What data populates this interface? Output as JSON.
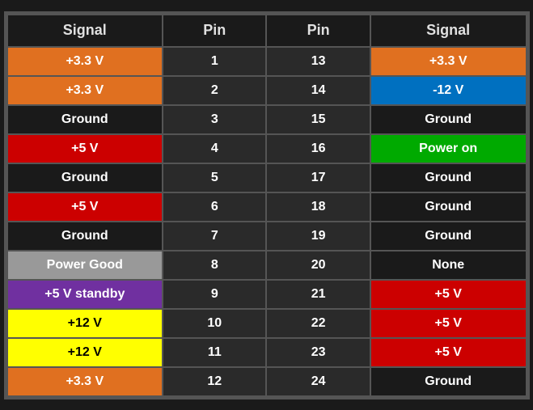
{
  "table": {
    "headers": [
      "Signal",
      "Pin",
      "Pin",
      "Signal"
    ],
    "rows": [
      {
        "left_signal": "+3.3 V",
        "left_class": "bg-orange",
        "pin_left": "1",
        "pin_right": "13",
        "right_signal": "+3.3 V",
        "right_class": "bg-orange"
      },
      {
        "left_signal": "+3.3 V",
        "left_class": "bg-orange",
        "pin_left": "2",
        "pin_right": "14",
        "right_signal": "-12 V",
        "right_class": "bg-blue"
      },
      {
        "left_signal": "Ground",
        "left_class": "bg-black",
        "pin_left": "3",
        "pin_right": "15",
        "right_signal": "Ground",
        "right_class": "bg-black"
      },
      {
        "left_signal": "+5 V",
        "left_class": "bg-red",
        "pin_left": "4",
        "pin_right": "16",
        "right_signal": "Power on",
        "right_class": "bg-green"
      },
      {
        "left_signal": "Ground",
        "left_class": "bg-black",
        "pin_left": "5",
        "pin_right": "17",
        "right_signal": "Ground",
        "right_class": "bg-black"
      },
      {
        "left_signal": "+5 V",
        "left_class": "bg-red",
        "pin_left": "6",
        "pin_right": "18",
        "right_signal": "Ground",
        "right_class": "bg-black"
      },
      {
        "left_signal": "Ground",
        "left_class": "bg-black",
        "pin_left": "7",
        "pin_right": "19",
        "right_signal": "Ground",
        "right_class": "bg-black"
      },
      {
        "left_signal": "Power Good",
        "left_class": "bg-gray",
        "pin_left": "8",
        "pin_right": "20",
        "right_signal": "None",
        "right_class": "bg-none"
      },
      {
        "left_signal": "+5 V standby",
        "left_class": "bg-purple",
        "pin_left": "9",
        "pin_right": "21",
        "right_signal": "+5 V",
        "right_class": "bg-red"
      },
      {
        "left_signal": "+12 V",
        "left_class": "bg-yellow",
        "pin_left": "10",
        "pin_right": "22",
        "right_signal": "+5 V",
        "right_class": "bg-red"
      },
      {
        "left_signal": "+12 V",
        "left_class": "bg-yellow",
        "pin_left": "11",
        "pin_right": "23",
        "right_signal": "+5 V",
        "right_class": "bg-red"
      },
      {
        "left_signal": "+3.3 V",
        "left_class": "bg-orange",
        "pin_left": "12",
        "pin_right": "24",
        "right_signal": "Ground",
        "right_class": "bg-black"
      }
    ]
  }
}
